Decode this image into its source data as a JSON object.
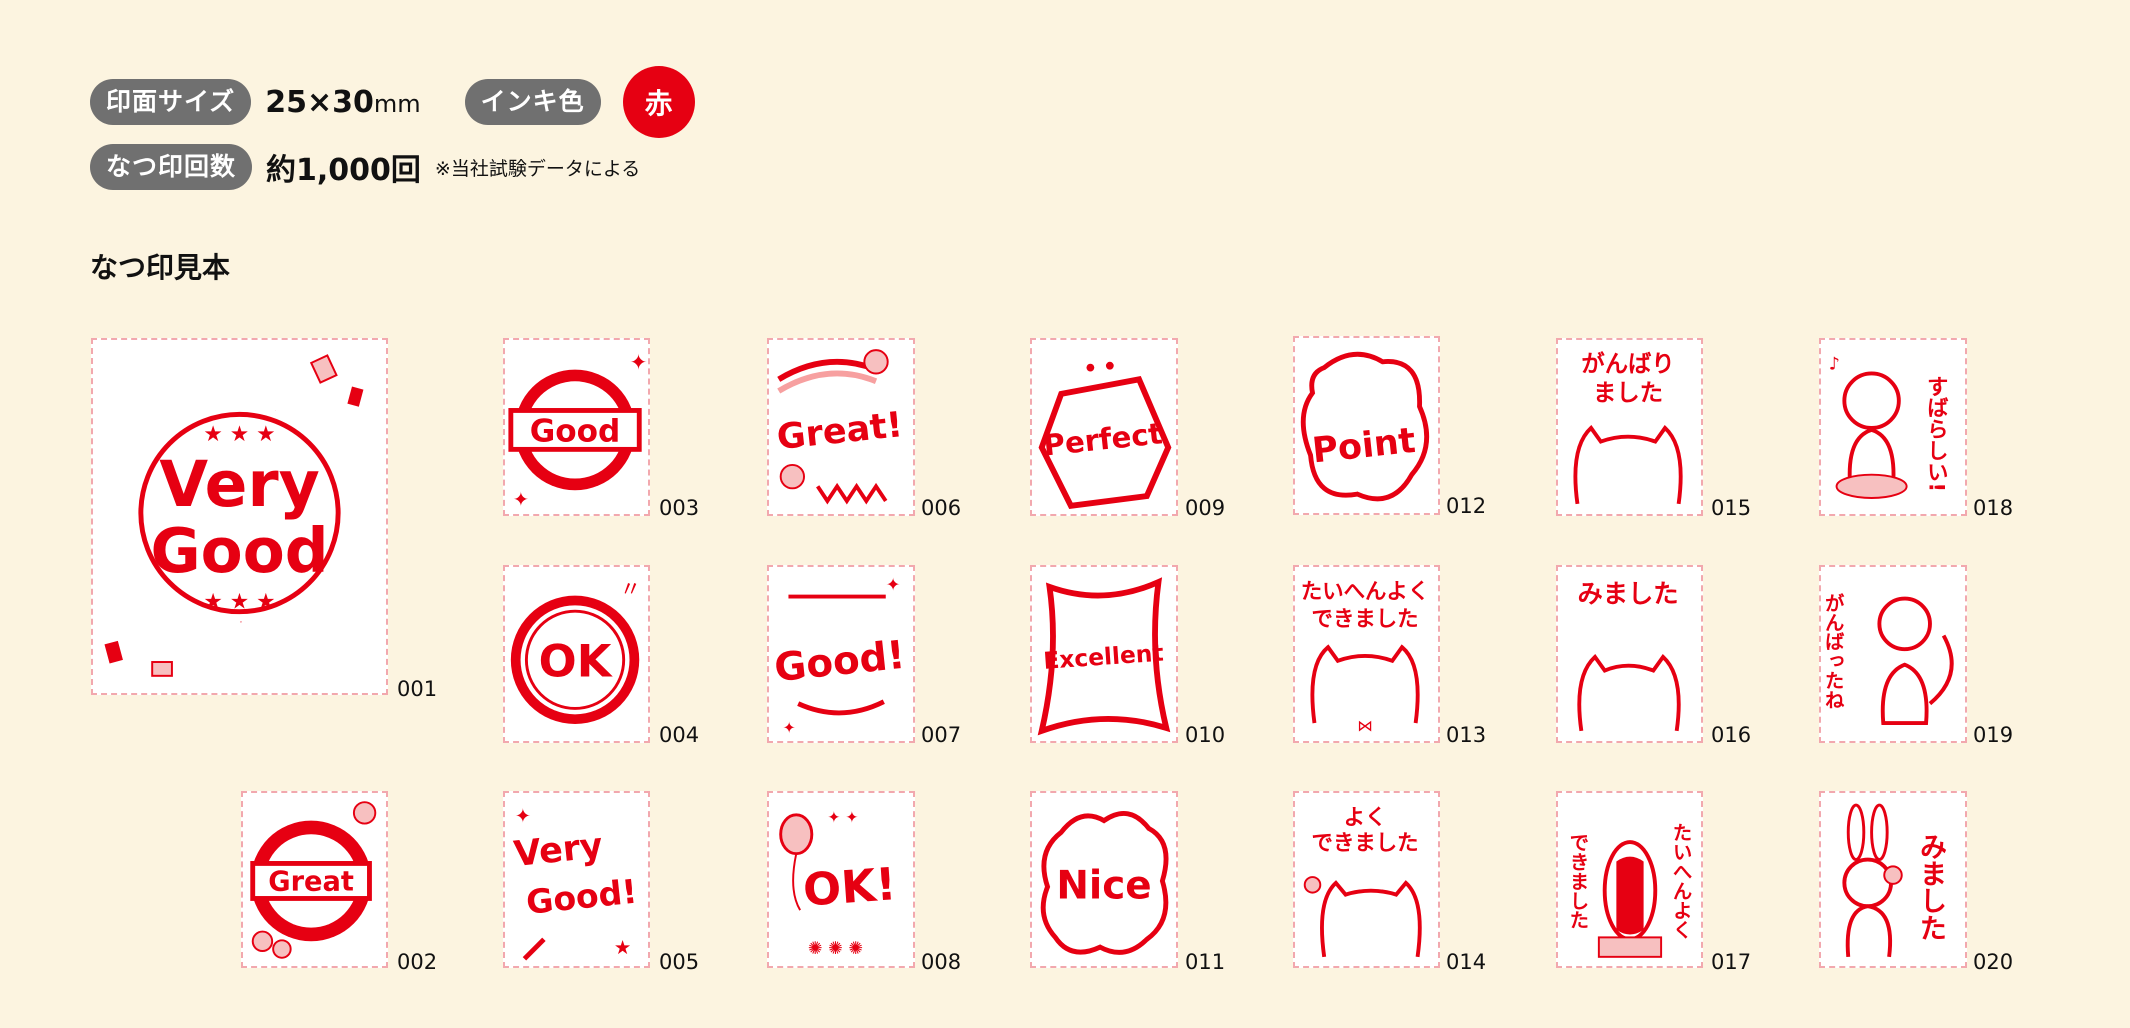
{
  "specs": {
    "size_label": "印面サイズ",
    "size_value": "25×30",
    "size_unit": "mm",
    "ink_label": "インキ色",
    "ink_value": "赤",
    "count_label": "なつ印回数",
    "count_value": "約1,000回",
    "count_note": "※当社試験データによる"
  },
  "section_title": "なつ印見本",
  "colors": {
    "background": "#fcf4e0",
    "stamp_red": "#e60012",
    "pill_gray": "#707070",
    "stamp_border": "#f2a8ae"
  },
  "stamps": [
    {
      "num": "001",
      "text": "Very Good"
    },
    {
      "num": "002",
      "text": "Great"
    },
    {
      "num": "003",
      "text": "Good"
    },
    {
      "num": "004",
      "text": "OK"
    },
    {
      "num": "005",
      "text": "Very Good!"
    },
    {
      "num": "006",
      "text": "Great!"
    },
    {
      "num": "007",
      "text": "Good!"
    },
    {
      "num": "008",
      "text": "OK!"
    },
    {
      "num": "009",
      "text": "Perfect"
    },
    {
      "num": "010",
      "text": "Excellent"
    },
    {
      "num": "011",
      "text": "Nice"
    },
    {
      "num": "012",
      "text": "Point"
    },
    {
      "num": "013",
      "text": "たいへんよくできました"
    },
    {
      "num": "014",
      "text": "よくできました"
    },
    {
      "num": "015",
      "text": "がんばりました"
    },
    {
      "num": "016",
      "text": "みました"
    },
    {
      "num": "017",
      "text": "たいへんよくできました"
    },
    {
      "num": "018",
      "text": "すばらしい!"
    },
    {
      "num": "019",
      "text": "がんばったね"
    },
    {
      "num": "020",
      "text": "みました"
    }
  ]
}
